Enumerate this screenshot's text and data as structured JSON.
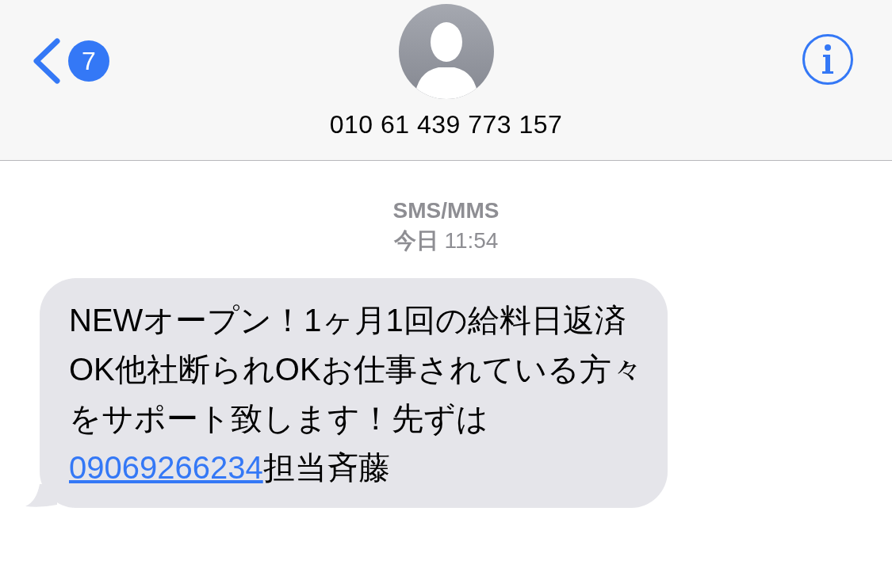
{
  "header": {
    "unread_count": "7",
    "contact": "010 61 439 773 157"
  },
  "conversation": {
    "service": "SMS/MMS",
    "timestamp": "**今日** 11:54"
  },
  "messages": [
    {
      "kind": "incoming",
      "text_before": "NEWオープン！1ヶ月1回の給料日返済OK他社断られOKお仕事されている方々をサポート致します！先ずは",
      "link": "09069266234",
      "text_after": "担当斉藤"
    }
  ]
}
